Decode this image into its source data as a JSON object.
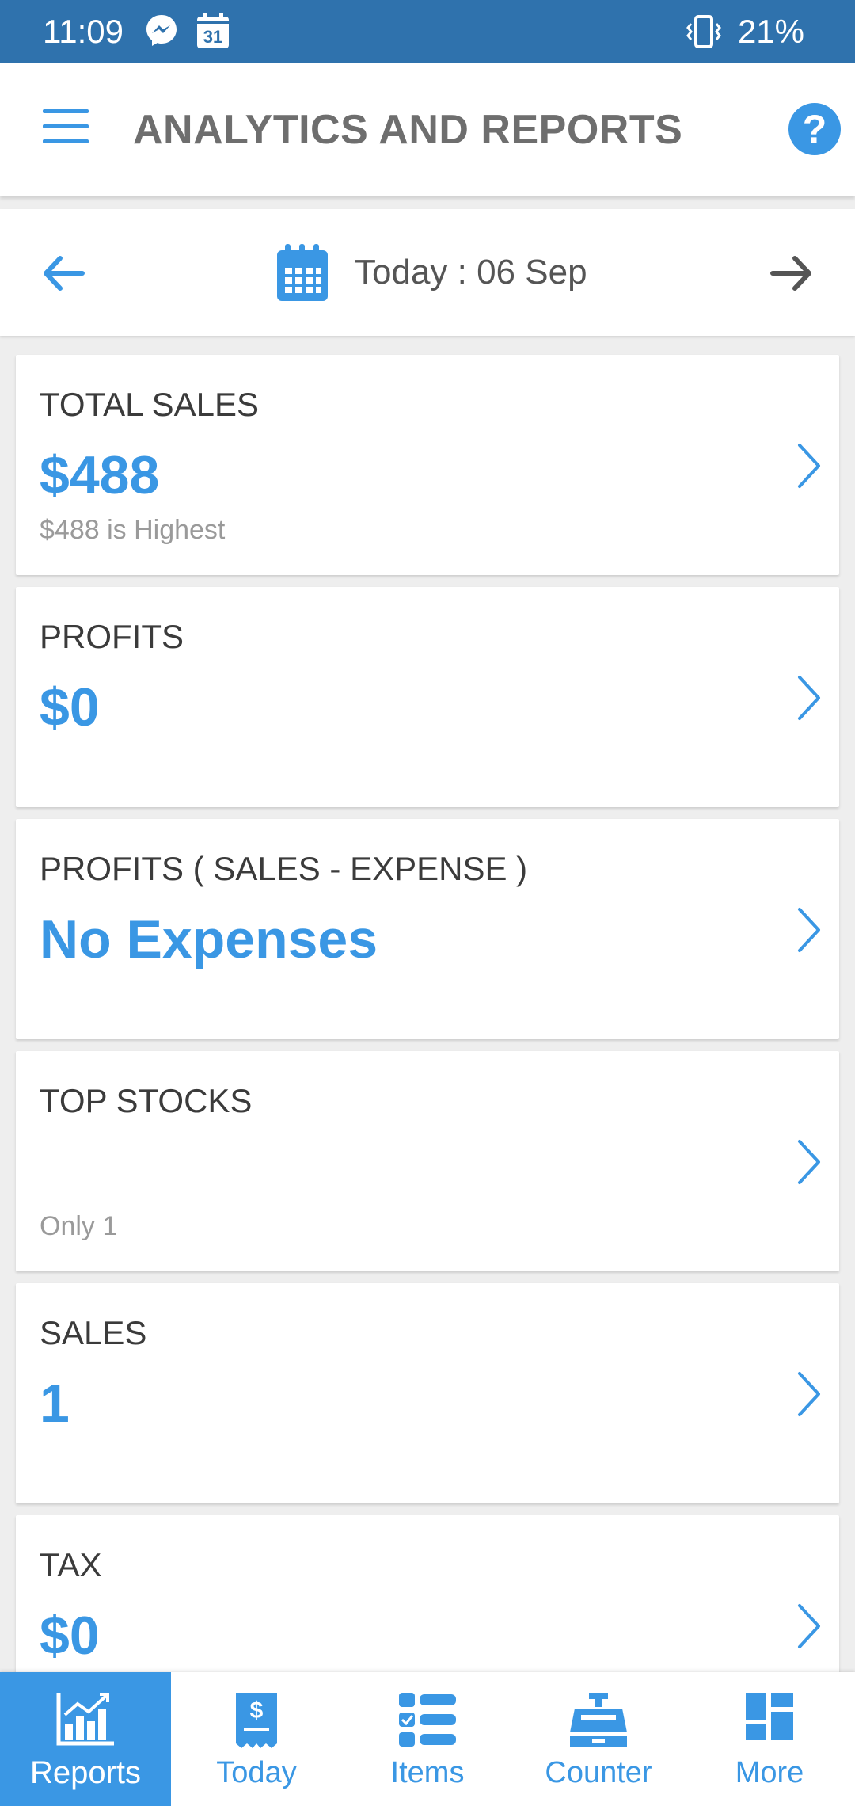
{
  "status_bar": {
    "time": "11:09",
    "calendar_day": "31",
    "battery": "21%"
  },
  "app_bar": {
    "title": "ANALYTICS AND REPORTS",
    "help_label": "?"
  },
  "date_nav": {
    "label": "Today : 06 Sep"
  },
  "cards": [
    {
      "title": "TOTAL SALES",
      "value": "$488",
      "sub": "$488 is Highest"
    },
    {
      "title": "PROFITS",
      "value": "$0",
      "sub": ""
    },
    {
      "title": "PROFITS ( SALES - EXPENSE )",
      "value": "No Expenses",
      "sub": ""
    },
    {
      "title": "TOP STOCKS",
      "value": "",
      "sub": "Only 1"
    },
    {
      "title": "SALES",
      "value": "1",
      "sub": ""
    },
    {
      "title": "TAX",
      "value": "$0",
      "sub": ""
    }
  ],
  "bottom_nav": {
    "tabs": [
      {
        "label": "Reports",
        "icon": "chart-icon"
      },
      {
        "label": "Today",
        "icon": "receipt-icon"
      },
      {
        "label": "Items",
        "icon": "list-icon"
      },
      {
        "label": "Counter",
        "icon": "cash-register-icon"
      },
      {
        "label": "More",
        "icon": "dashboard-icon"
      }
    ]
  },
  "colors": {
    "status_bar": "#2f72ad",
    "accent": "#3a97e4",
    "title_text": "#6e6e6e"
  }
}
